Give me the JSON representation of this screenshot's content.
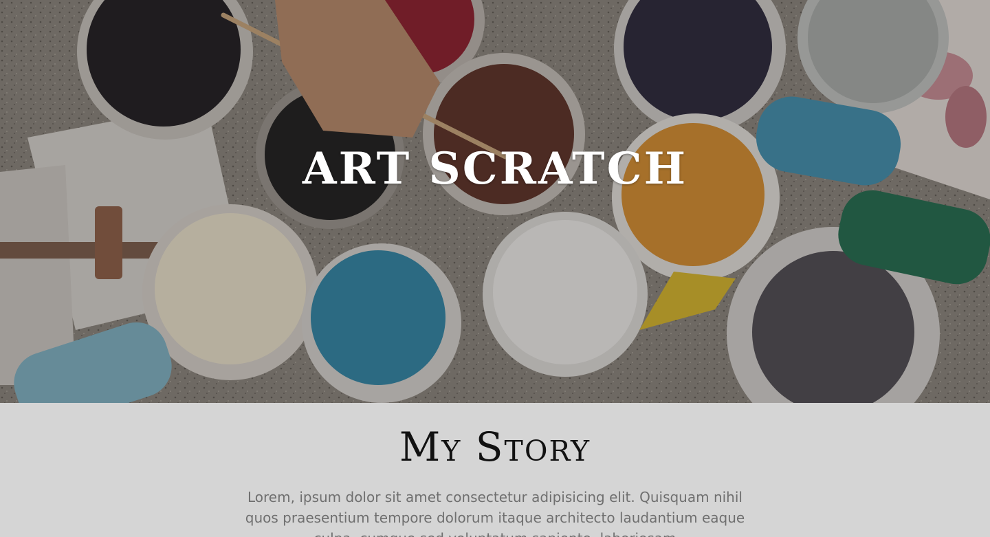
{
  "hero": {
    "title": "ART SCRATCH",
    "image": "paint-buckets-photo"
  },
  "story": {
    "heading": "My Story",
    "body": "Lorem, ipsum dolor sit amet consectetur adipisicing elit. Quisquam nihil quos praesentium tempore dolorum itaque architecto laudantium eaque culpa, cumque sed voluptatum sapiente, laboriosam"
  },
  "colors": {
    "story_background": "#d5d5d5",
    "heading_text": "#111111",
    "body_text": "#6f6f6f",
    "hero_text": "#ffffff"
  }
}
